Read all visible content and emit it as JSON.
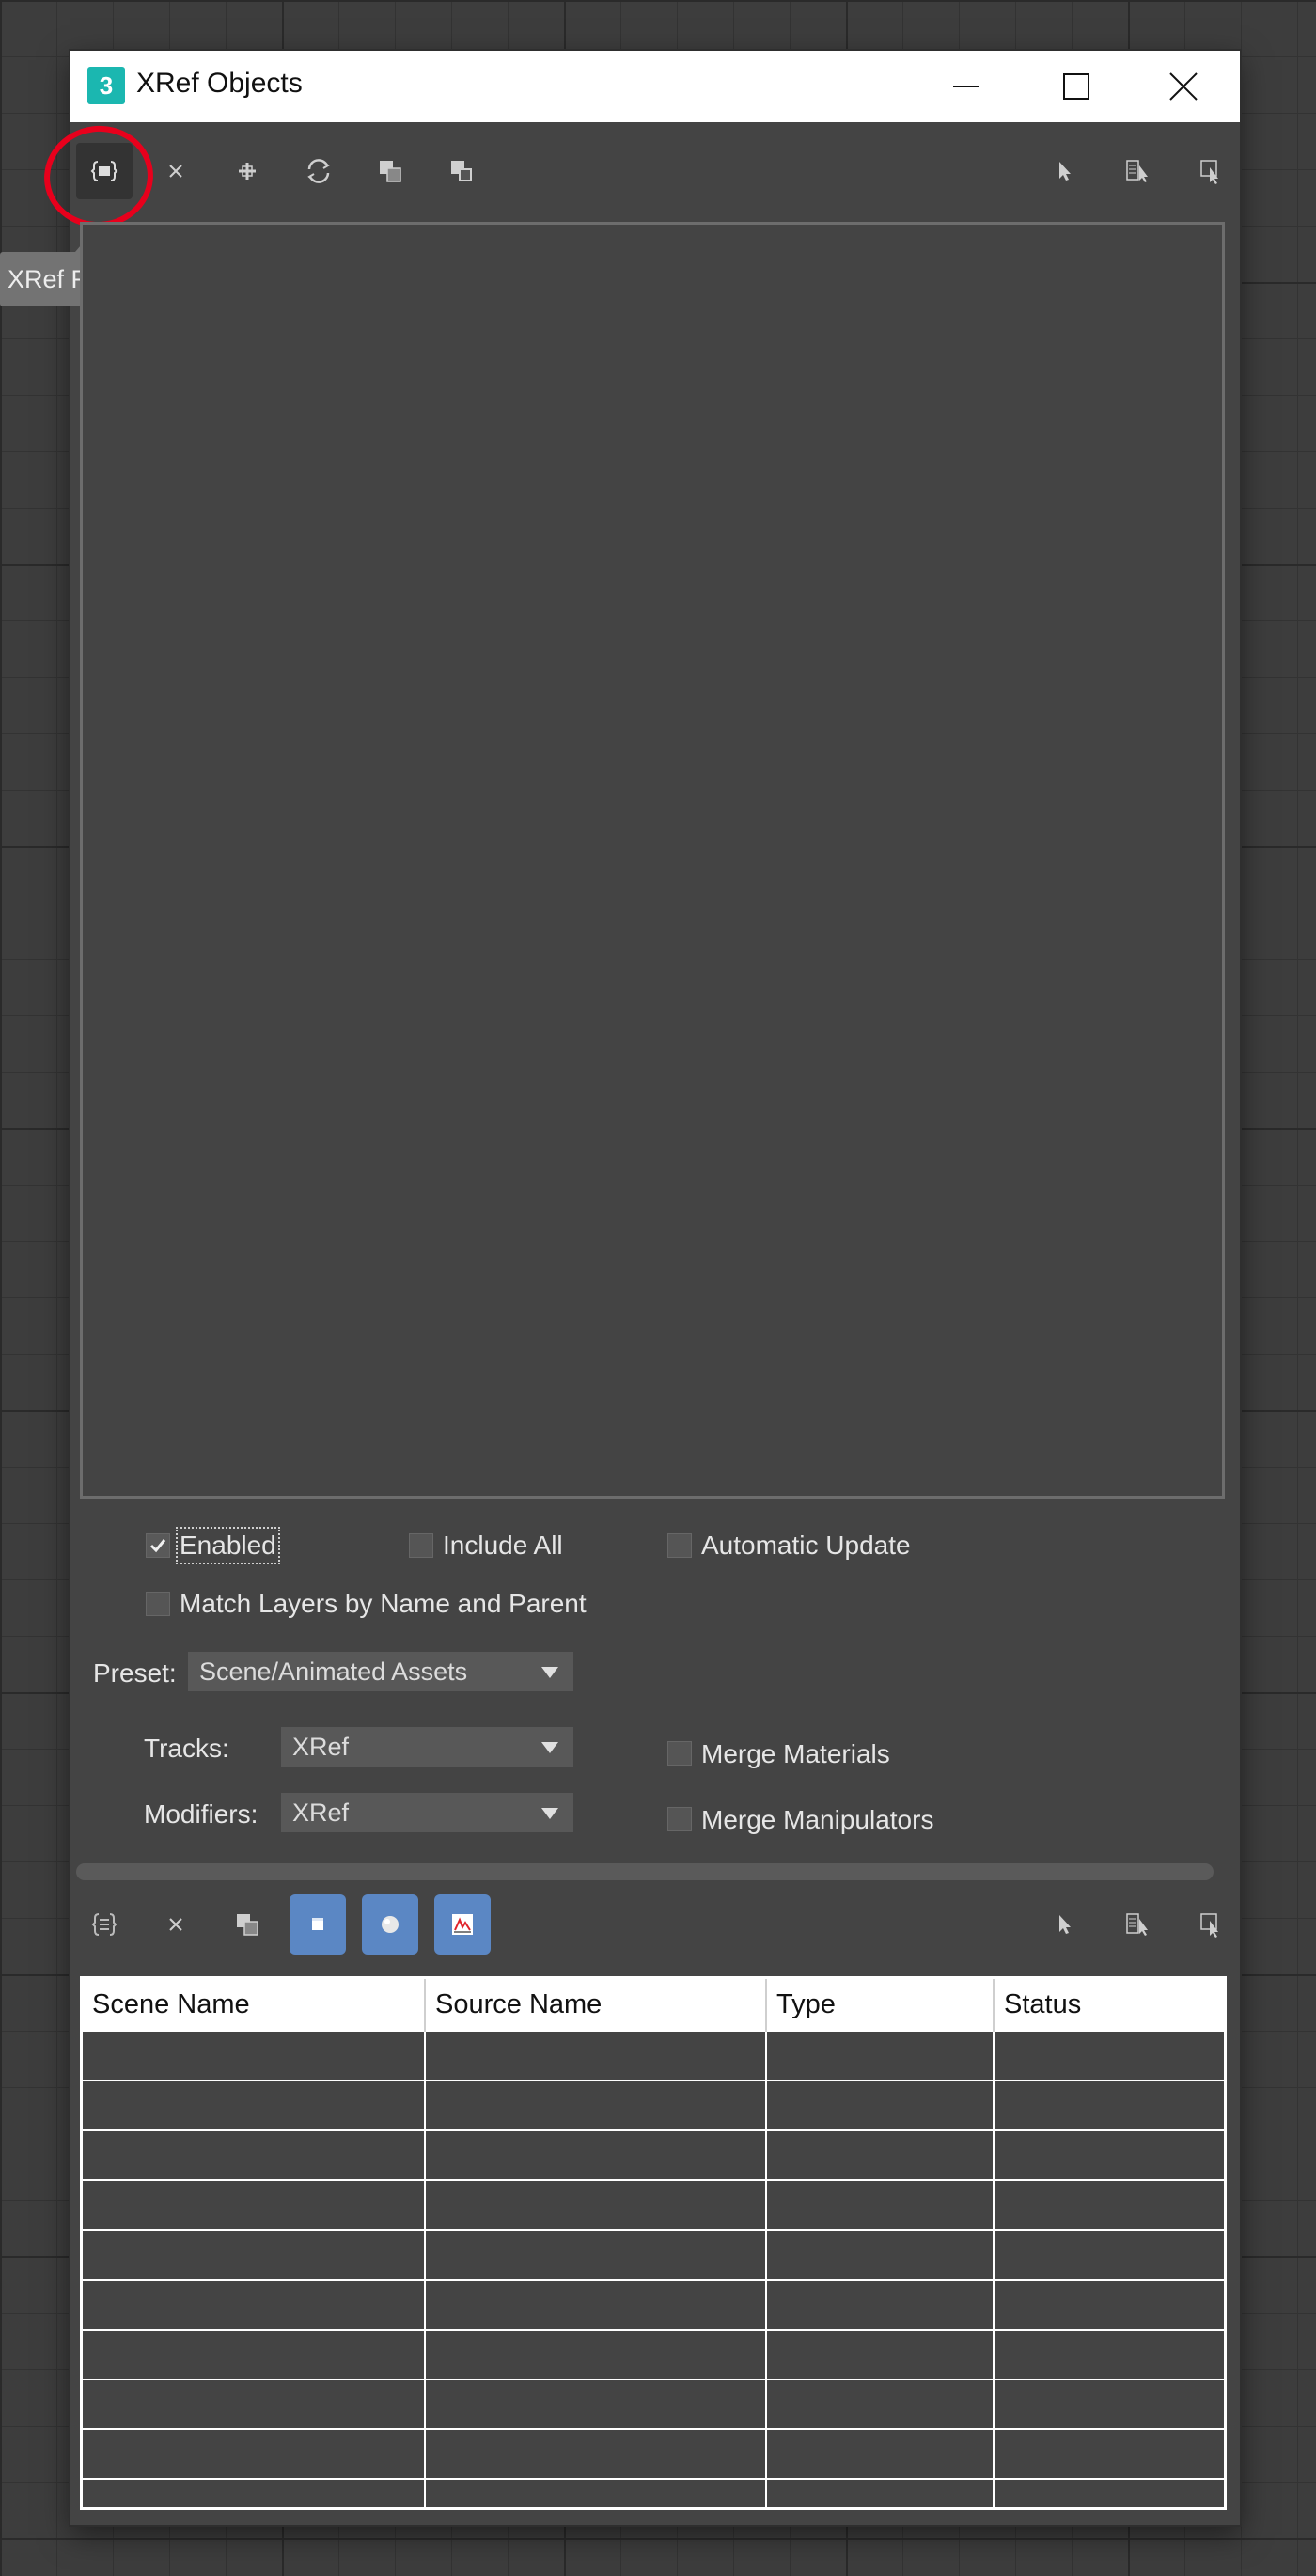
{
  "window": {
    "title": "XRef Objects",
    "app_icon_text": "3"
  },
  "top_toolbar": {
    "icons": [
      "xref-record-from-file-icon",
      "remove-icon",
      "add-icon",
      "refresh-icon",
      "convert-selected-icon",
      "merge-icon",
      "select-icon",
      "select-by-name-icon",
      "highlight-icon"
    ]
  },
  "tooltip": {
    "text": "XRef Record from File..."
  },
  "options": {
    "enabled": {
      "label": "Enabled",
      "checked": true
    },
    "include_all": {
      "label": "Include All",
      "checked": false
    },
    "automatic_update": {
      "label": "Automatic Update",
      "checked": false
    },
    "match_layers": {
      "label": "Match Layers by Name and Parent",
      "checked": false
    },
    "preset_label": "Preset:",
    "preset_value": "Scene/Animated Assets",
    "tracks_label": "Tracks:",
    "tracks_value": "XRef",
    "modifiers_label": "Modifiers:",
    "modifiers_value": "XRef",
    "merge_materials": {
      "label": "Merge Materials",
      "checked": false
    },
    "merge_manipulators": {
      "label": "Merge Manipulators",
      "checked": false
    }
  },
  "bottom_toolbar": {
    "icons": [
      "add-object-icon",
      "remove-icon",
      "merge-icon",
      "object-icon",
      "material-icon",
      "controller-icon",
      "select-icon",
      "select-by-name-icon",
      "highlight-icon"
    ]
  },
  "table": {
    "columns": [
      "Scene Name",
      "Source Name",
      "Type",
      "Status"
    ],
    "rows": []
  },
  "colors": {
    "dialog_bg": "#444444",
    "accent_blue": "#5b87c4",
    "annotation_red": "#e8001c"
  }
}
